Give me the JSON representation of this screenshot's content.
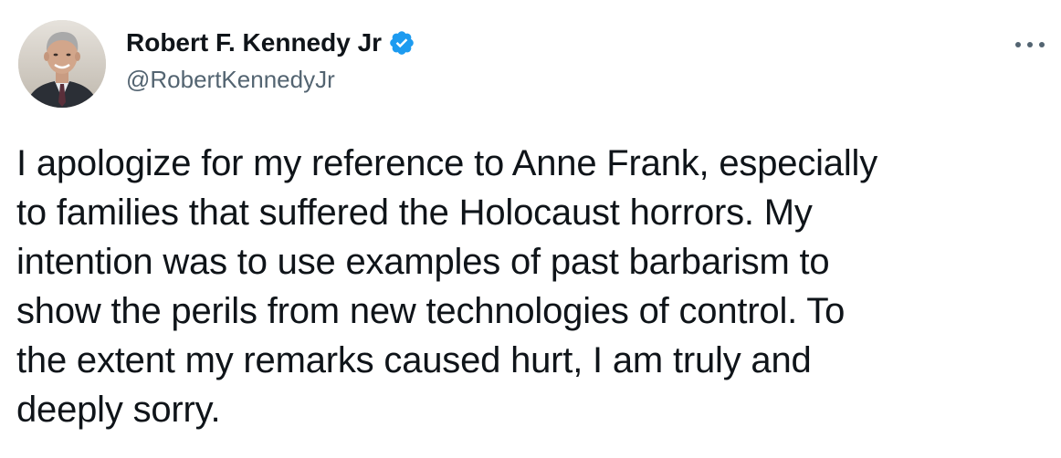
{
  "author": {
    "display_name": "Robert F. Kennedy Jr",
    "handle": "@RobertKennedyJr",
    "verified": true
  },
  "tweet": {
    "lines": [
      "I apologize for my reference to Anne Frank, especially",
      "to families that suffered the Holocaust horrors. My",
      "intention was to use examples of past barbarism to",
      "show the perils from new technologies of control. To",
      "the extent my remarks caused hurt, I am truly and",
      "deeply sorry."
    ]
  },
  "icons": {
    "verified": "verified-badge-icon",
    "more": "more-options-icon"
  },
  "colors": {
    "text": "#0f1419",
    "secondary": "#536471",
    "verified_blue": "#1d9bf0"
  }
}
